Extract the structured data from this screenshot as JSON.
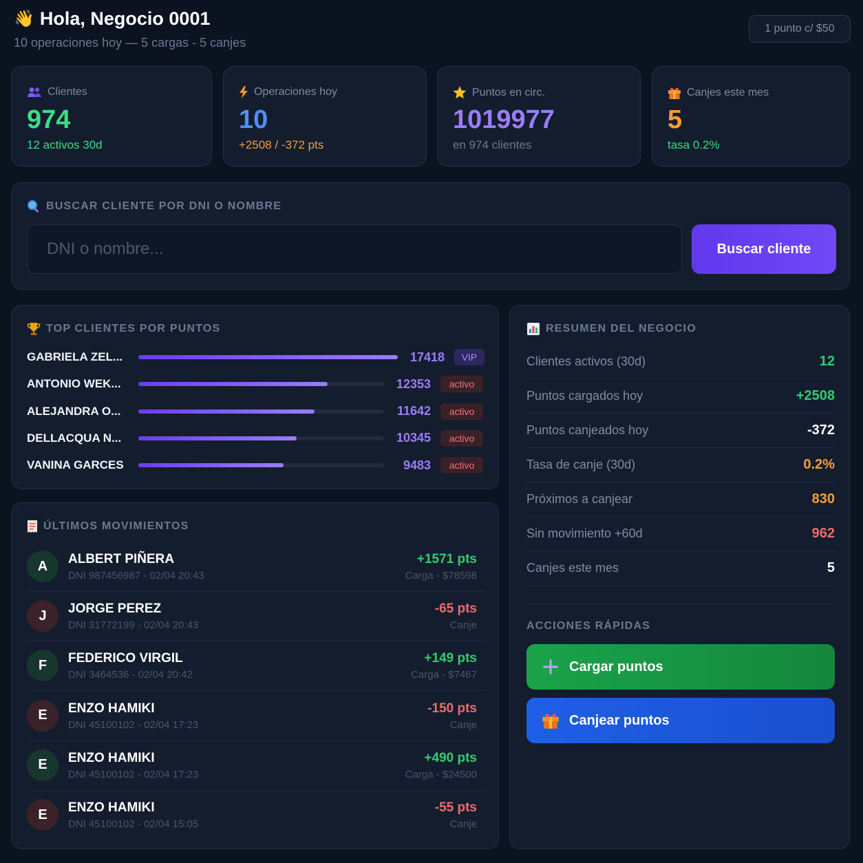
{
  "header": {
    "title": "Hola, Negocio 0001",
    "subtitle": "10 operaciones hoy — 5 cargas - 5 canjes",
    "rate": "1 punto c/ $50"
  },
  "stats": [
    {
      "label": "Clientes",
      "value": "974",
      "sub": "12 activos 30d",
      "icon": "users-icon",
      "value_color": "#3ddc84",
      "sub_color": "#3ddc84"
    },
    {
      "label": "Operaciones hoy",
      "value": "10",
      "sub": "+2508 / -372 pts",
      "icon": "lightning-icon",
      "value_color": "#4f8ff7",
      "sub_color": "#f59e3b"
    },
    {
      "label": "Puntos en circ.",
      "value": "1019977",
      "sub": "en 974 clientes",
      "icon": "star-icon",
      "value_color": "#9b7cf8",
      "sub_color": "#6b7890"
    },
    {
      "label": "Canjes este mes",
      "value": "5",
      "sub": "tasa 0.2%",
      "icon": "gift-icon",
      "value_color": "#f59e3b",
      "sub_color": "#3ddc84"
    }
  ],
  "search": {
    "title": "BUSCAR CLIENTE POR DNI O NOMBRE",
    "placeholder": "DNI o nombre...",
    "value": "",
    "button": "Buscar cliente"
  },
  "top_clients": {
    "title": "TOP CLIENTES POR PUNTOS",
    "items": [
      {
        "name": "GABRIELA ZEL...",
        "points": "17418",
        "fraction": 1.0,
        "tag": "VIP",
        "tag_kind": "vip"
      },
      {
        "name": "ANTONIO WEK...",
        "points": "12353",
        "fraction": 0.73,
        "tag": "activo",
        "tag_kind": "act"
      },
      {
        "name": "ALEJANDRA O...",
        "points": "11642",
        "fraction": 0.68,
        "tag": "activo",
        "tag_kind": "act"
      },
      {
        "name": "DELLACQUA N...",
        "points": "10345",
        "fraction": 0.61,
        "tag": "activo",
        "tag_kind": "act"
      },
      {
        "name": "VANINA GARCES",
        "points": "9483",
        "fraction": 0.56,
        "tag": "activo",
        "tag_kind": "act"
      }
    ]
  },
  "movements": {
    "title": "ÚLTIMOS MOVIMIENTOS",
    "items": [
      {
        "initial": "A",
        "name": "ALBERT PIÑERA",
        "meta": "DNI 987456987 - 02/04 20:43",
        "pts": "+1571 pts",
        "type": "Carga - $78598",
        "kind": "pos"
      },
      {
        "initial": "J",
        "name": "JORGE PEREZ",
        "meta": "DNI 31772199 - 02/04 20:43",
        "pts": "-65 pts",
        "type": "Canje",
        "kind": "neg"
      },
      {
        "initial": "F",
        "name": "FEDERICO VIRGIL",
        "meta": "DNI 3464536 - 02/04 20:42",
        "pts": "+149 pts",
        "type": "Carga - $7467",
        "kind": "pos"
      },
      {
        "initial": "E",
        "name": "ENZO HAMIKI",
        "meta": "DNI 45100102 - 02/04 17:23",
        "pts": "-150 pts",
        "type": "Canje",
        "kind": "neg"
      },
      {
        "initial": "E",
        "name": "ENZO HAMIKI",
        "meta": "DNI 45100102 - 02/04 17:23",
        "pts": "+490 pts",
        "type": "Carga - $24500",
        "kind": "pos"
      },
      {
        "initial": "E",
        "name": "ENZO HAMIKI",
        "meta": "DNI 45100102 - 02/04 15:05",
        "pts": "-55 pts",
        "type": "Canje",
        "kind": "neg"
      }
    ]
  },
  "summary": {
    "title": "RESUMEN DEL NEGOCIO",
    "rows": [
      {
        "label": "Clientes activos (30d)",
        "value": "12",
        "color": "#33cc6f"
      },
      {
        "label": "Puntos cargados hoy",
        "value": "+2508",
        "color": "#33cc6f"
      },
      {
        "label": "Puntos canjeados hoy",
        "value": "-372",
        "color": "#ffffff"
      },
      {
        "label": "Tasa de canje (30d)",
        "value": "0.2%",
        "color": "#f59e3b"
      },
      {
        "label": "Próximos a canjear",
        "value": "830",
        "color": "#f59e3b"
      },
      {
        "label": "Sin movimiento +60d",
        "value": "962",
        "color": "#ef6b6b"
      },
      {
        "label": "Canjes este mes",
        "value": "5",
        "color": "#ffffff"
      }
    ]
  },
  "quick_actions": {
    "title": "ACCIONES RÁPIDAS",
    "load": "Cargar puntos",
    "redeem": "Canjear puntos"
  }
}
